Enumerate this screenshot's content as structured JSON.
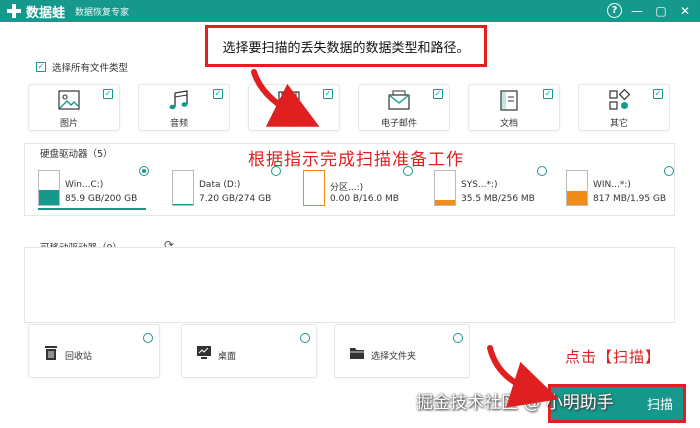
{
  "titlebar": {
    "app_name": "数据蛙",
    "subtitle": "数据恢复专家",
    "help": "?",
    "minimize": "—",
    "maximize": "▢",
    "close": "✕"
  },
  "annotations": {
    "top_callout": "选择要扫描的丢失数据的数据类型和路径。",
    "middle": "根据指示完成扫描准备工作",
    "bottom": "点击【扫描】"
  },
  "file_types": {
    "select_all_label": "选择所有文件类型",
    "items": [
      {
        "label": "图片",
        "checked": true,
        "icon": "image-icon"
      },
      {
        "label": "音频",
        "checked": true,
        "icon": "music-icon"
      },
      {
        "label": "视频",
        "checked": true,
        "icon": "video-icon"
      },
      {
        "label": "电子邮件",
        "checked": true,
        "icon": "mail-icon"
      },
      {
        "label": "文档",
        "checked": true,
        "icon": "document-icon"
      },
      {
        "label": "其它",
        "checked": true,
        "icon": "other-icon"
      }
    ]
  },
  "hard_drives": {
    "title": "硬盘驱动器（5）",
    "items": [
      {
        "name": "Win...C:)",
        "size": "85.9 GB/200 GB",
        "used": 0.43,
        "color": "#16998c",
        "selected": true
      },
      {
        "name": "Data (D:)",
        "size": "7.20 GB/274 GB",
        "used": 0.03,
        "color": "#16998c",
        "selected": false
      },
      {
        "name": "分区...:)",
        "size": "0.00  B/16.0 MB",
        "used": 0.0,
        "color": "#f08c1a",
        "selected": false
      },
      {
        "name": "SYS...*:)",
        "size": "35.5 MB/256 MB",
        "used": 0.14,
        "color": "#f08c1a",
        "selected": false
      },
      {
        "name": "WIN...*:)",
        "size": "817 MB/1.95 GB",
        "used": 0.42,
        "color": "#f08c1a",
        "selected": false
      }
    ]
  },
  "removable": {
    "title": "可移动驱动器（0）"
  },
  "locations": [
    {
      "label": "回收站",
      "icon": "recycle-bin-icon"
    },
    {
      "label": "桌面",
      "icon": "desktop-icon"
    },
    {
      "label": "选择文件夹",
      "icon": "folder-icon"
    }
  ],
  "scan_button": "扫描",
  "watermark": "掘金技术社区 @ 小明助手",
  "colors": {
    "brand": "#16998c",
    "annotation": "#e02020",
    "warning": "#f08c1a"
  }
}
